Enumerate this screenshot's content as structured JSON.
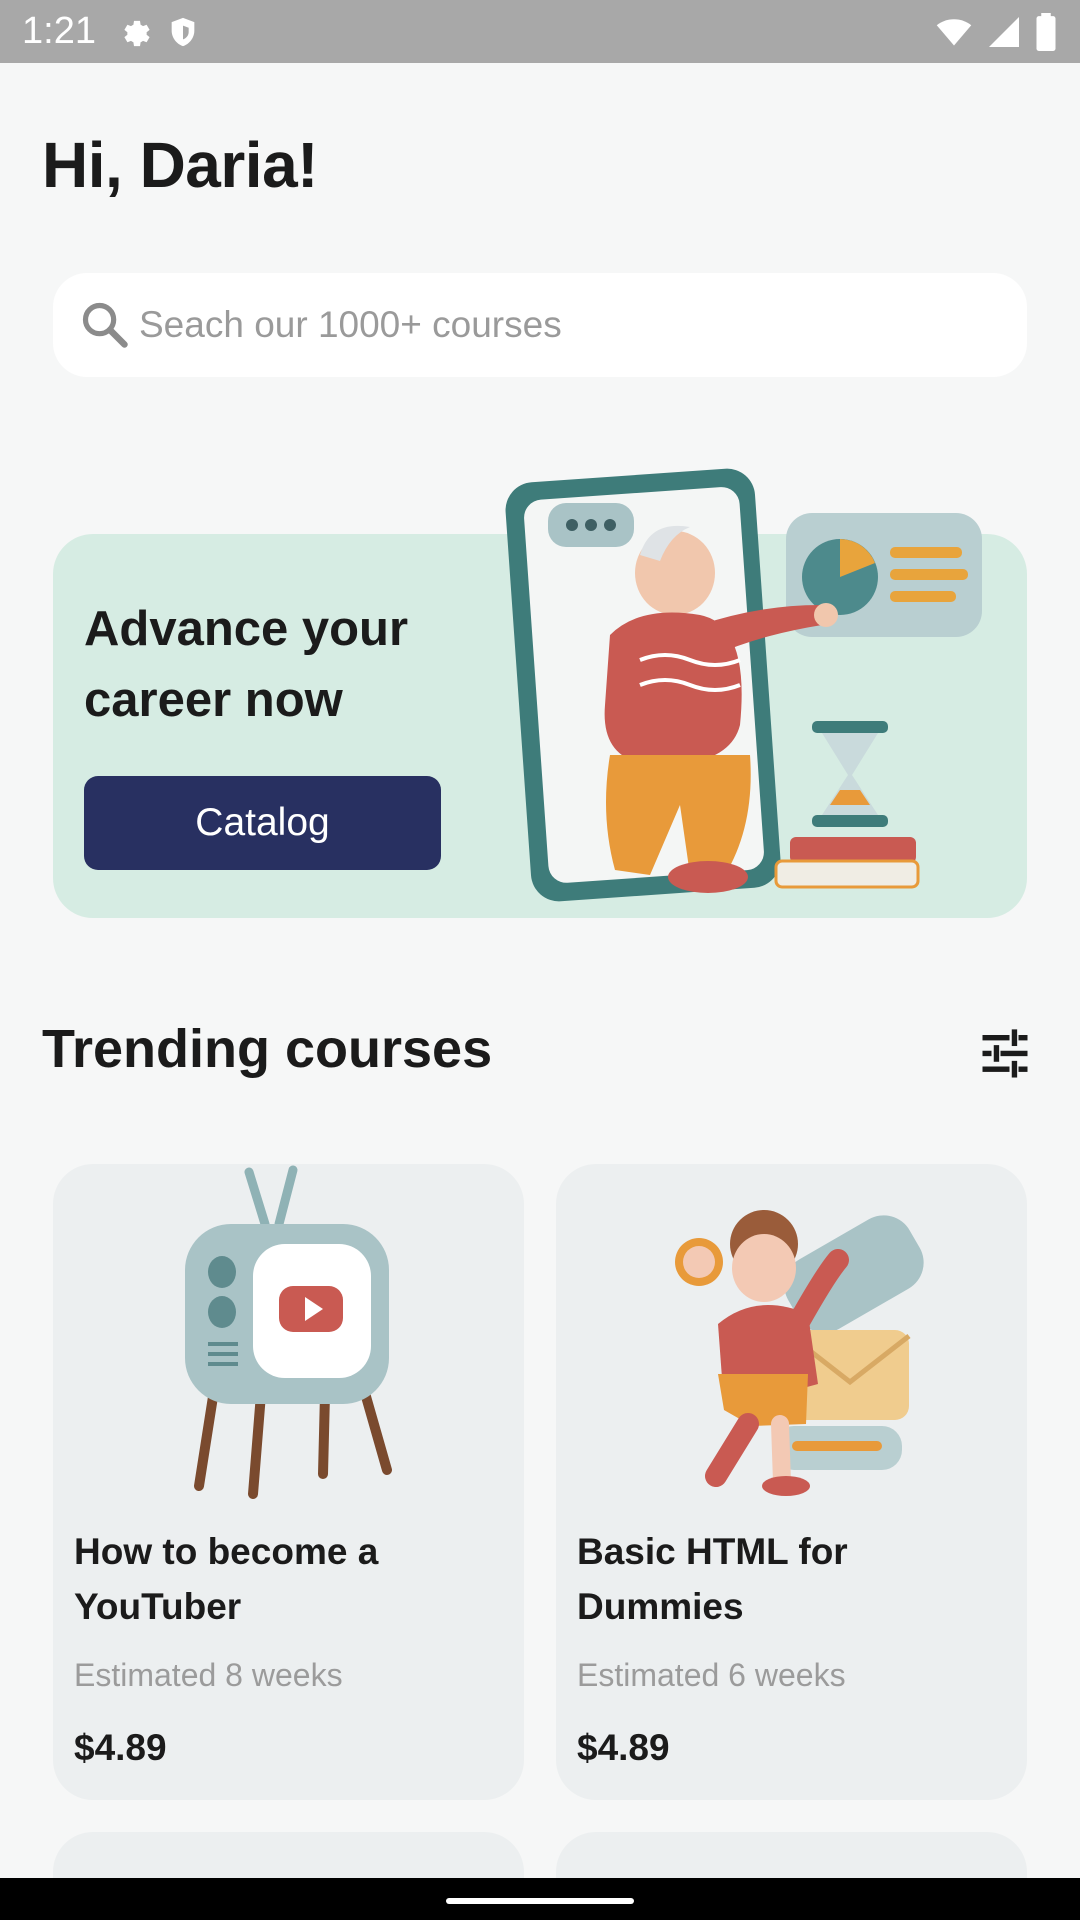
{
  "status_bar": {
    "time": "1:21",
    "icons": [
      "gear-icon",
      "shield-icon",
      "wifi-icon",
      "signal-icon",
      "battery-icon"
    ]
  },
  "greeting": "Hi, Daria!",
  "search": {
    "placeholder": "Seach our 1000+ courses",
    "icon": "search-icon"
  },
  "promo": {
    "title": "Advance your career now",
    "button_label": "Catalog"
  },
  "trending": {
    "title": "Trending courses",
    "filter_icon": "sliders-icon",
    "courses": [
      {
        "title": "How to become a YouTuber",
        "duration": "Estimated 8 weeks",
        "price": "$4.89"
      },
      {
        "title": "Basic HTML for Dummies",
        "duration": "Estimated 6 weeks",
        "price": "$4.89"
      }
    ]
  },
  "colors": {
    "background": "#f6f7f7",
    "promo_background": "#d6ece3",
    "button": "#283061",
    "card": "#eceff0",
    "muted_text": "#9b9b9b"
  }
}
